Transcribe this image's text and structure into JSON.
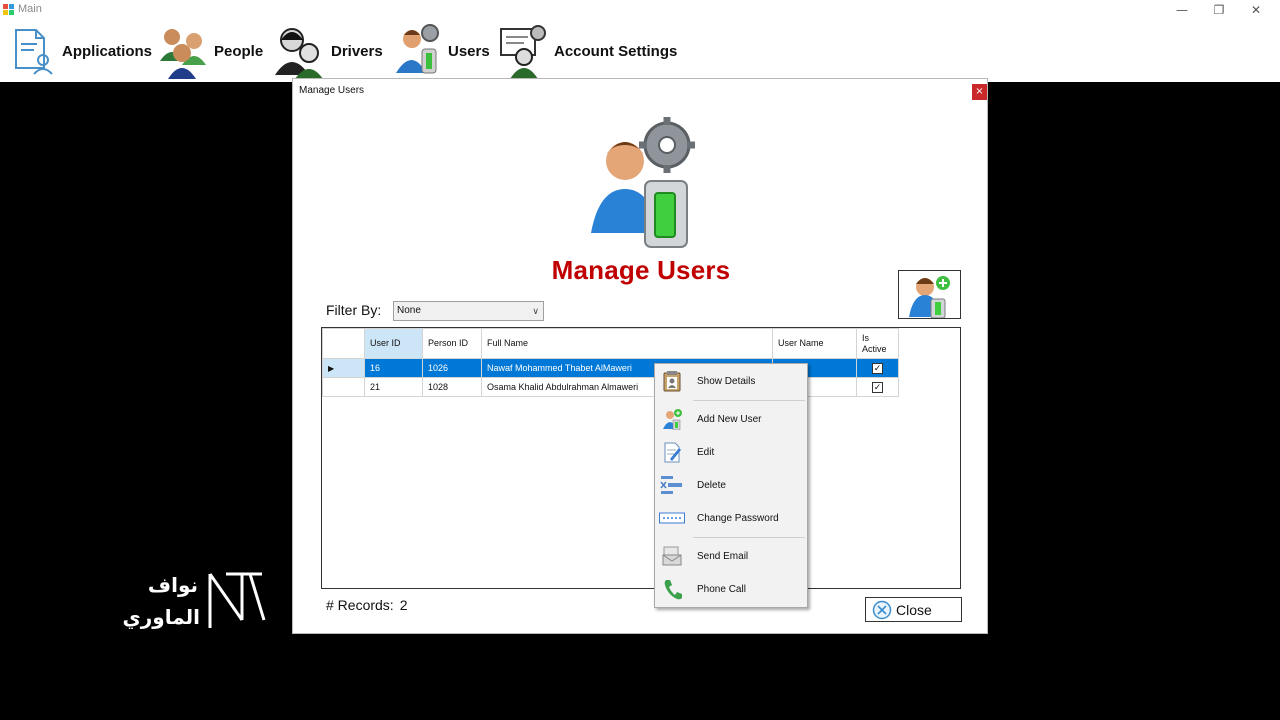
{
  "window": {
    "title": "Main",
    "minimize": "—",
    "restore": "❐",
    "close": "✕"
  },
  "menu": {
    "items": [
      {
        "label": "Applications",
        "icon": "applications-icon"
      },
      {
        "label": "People",
        "icon": "people-icon"
      },
      {
        "label": "Drivers",
        "icon": "drivers-icon"
      },
      {
        "label": "Users",
        "icon": "users-icon"
      },
      {
        "label": "Account Settings",
        "icon": "account-settings-icon"
      }
    ]
  },
  "dialog": {
    "title": "Manage Users",
    "close_label": "×",
    "heading": "Manage Users",
    "filter": {
      "label": "Filter By:",
      "selected": "None"
    },
    "grid": {
      "columns": [
        "User ID",
        "Person ID",
        "Full Name",
        "User Name",
        "Is Active"
      ],
      "rows": [
        {
          "user_id": "16",
          "person_id": "1026",
          "full_name": "Nawaf Mohammed Thabet AlMaweri",
          "user_name": "",
          "is_active": true
        },
        {
          "user_id": "21",
          "person_id": "1028",
          "full_name": "Osama Khalid Abdulrahman Almaweri",
          "user_name": "",
          "is_active": true
        }
      ]
    },
    "records": {
      "label": "# Records:",
      "count": "2"
    },
    "close_button": "Close"
  },
  "context_menu": {
    "items": [
      {
        "label": "Show Details",
        "icon": "show-details-icon"
      },
      {
        "label": "Add New User",
        "icon": "add-user-icon"
      },
      {
        "label": "Edit",
        "icon": "edit-icon"
      },
      {
        "label": "Delete",
        "icon": "delete-icon"
      },
      {
        "label": "Change Password",
        "icon": "password-icon"
      },
      {
        "label": "Send Email",
        "icon": "email-icon"
      },
      {
        "label": "Phone Call",
        "icon": "phone-icon"
      }
    ]
  },
  "watermark": {
    "text_line1": "نواف",
    "text_line2": "الماوري"
  },
  "colors": {
    "heading_red": "#c00000",
    "selection_blue": "#0078d7",
    "header_highlight": "#cde6f7"
  }
}
